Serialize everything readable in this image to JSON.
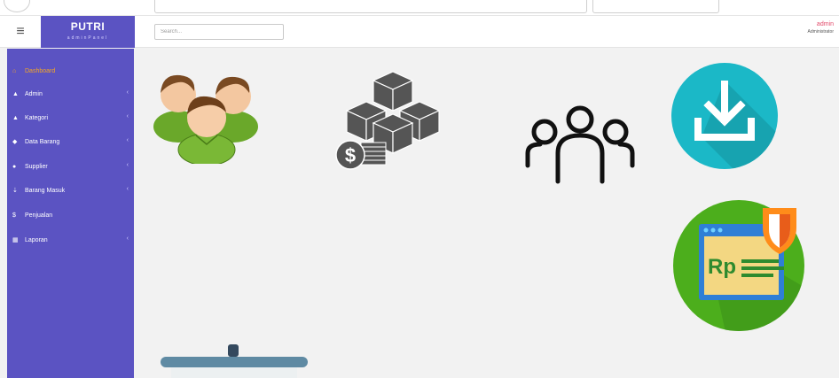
{
  "header": {
    "brand_title": "PUTRI",
    "brand_subtitle": "adminPanel",
    "search_placeholder": "Search...",
    "user_name": "admin",
    "user_role": "Administrator"
  },
  "sidebar": {
    "items": [
      {
        "label": "Dashboard",
        "icon": "home-icon",
        "active": true,
        "has_chevron": false
      },
      {
        "label": "Admin",
        "icon": "user-icon",
        "active": false,
        "has_chevron": true
      },
      {
        "label": "Kategori",
        "icon": "user-icon",
        "active": false,
        "has_chevron": true
      },
      {
        "label": "Data Barang",
        "icon": "tag-icon",
        "active": false,
        "has_chevron": true
      },
      {
        "label": "Supplier",
        "icon": "users-icon",
        "active": false,
        "has_chevron": true
      },
      {
        "label": "Barang Masuk",
        "icon": "download-icon",
        "active": false,
        "has_chevron": true
      },
      {
        "label": "Penjualan",
        "icon": "dollar-icon",
        "active": false,
        "has_chevron": false
      },
      {
        "label": "Laporan",
        "icon": "book-icon",
        "active": false,
        "has_chevron": true
      }
    ]
  },
  "colors": {
    "sidebar_bg": "#5b53c2",
    "active_item": "#f5a623",
    "user_name": "#e24a6a",
    "download_circle": "#1bb8c7",
    "payment_circle": "#4cae1c",
    "main_bg": "#f2f2f2"
  },
  "dashboard_tiles": [
    {
      "icon": "user-group-icon"
    },
    {
      "icon": "boxes-money-icon"
    },
    {
      "icon": "people-outline-icon"
    },
    {
      "icon": "download-circle-icon"
    },
    {
      "icon": "rupiah-payment-icon"
    },
    {
      "icon": "bucket-icon"
    }
  ]
}
